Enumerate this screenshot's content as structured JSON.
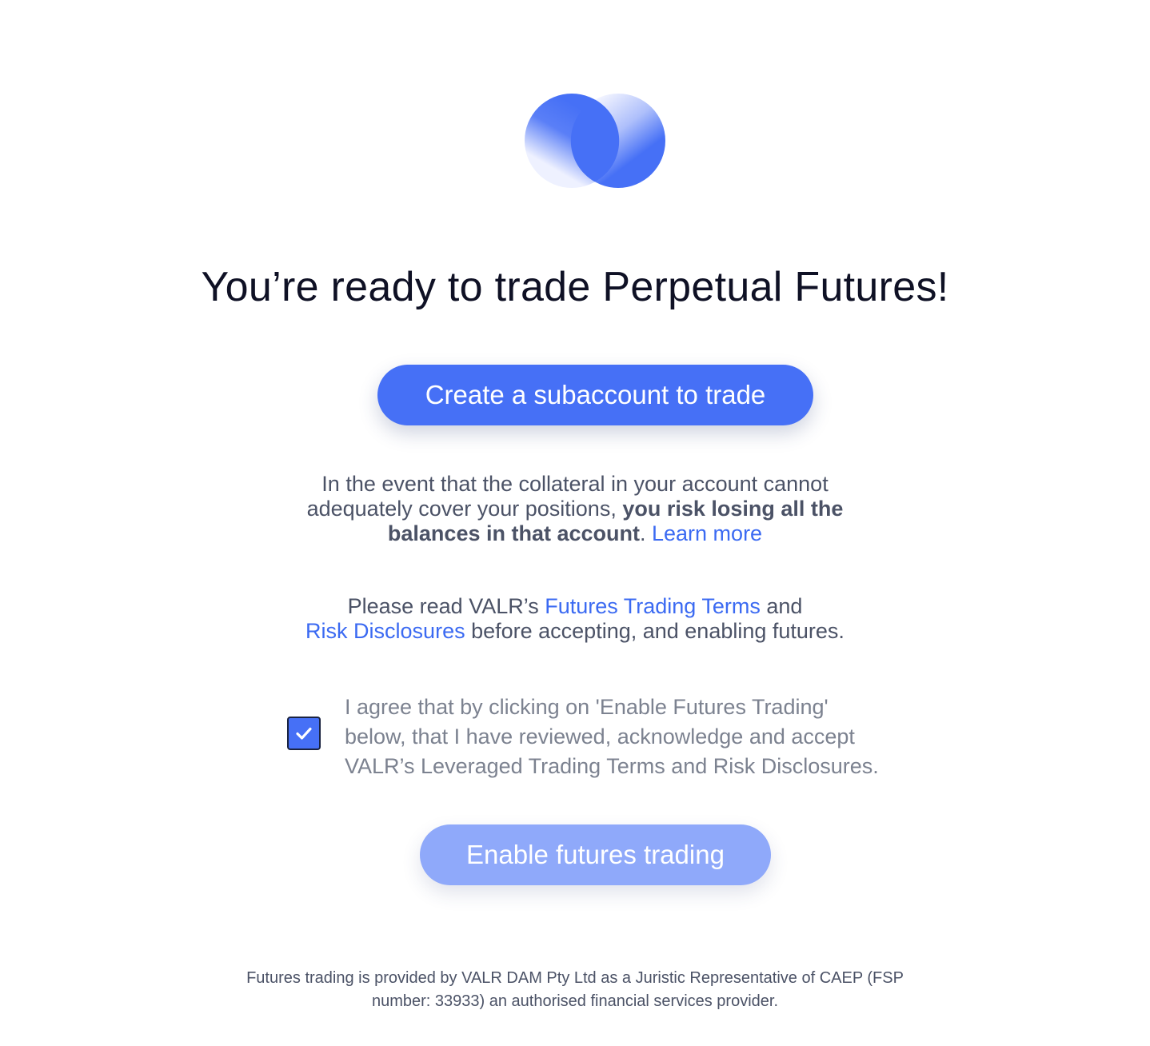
{
  "logo": {
    "name": "valr-logo",
    "colors": [
      "#4670f6",
      "#e6ebff"
    ]
  },
  "title": "You’re ready to trade Perpetual Futures!",
  "create_button": {
    "label": "Create a subaccount to trade",
    "color": "#4670f6"
  },
  "risk_notice": {
    "line1": "In the event that the collateral in your account cannot",
    "line2_start": "adequately cover your positions, ",
    "line2_bold": "you risk losing all the",
    "line3_bold": "balances in that account",
    "line3_after": ". ",
    "learn_more": "Learn more"
  },
  "terms_notice": {
    "prefix": "Please read VALR’s ",
    "futures_terms_link": "Futures Trading Terms",
    "middle": " and",
    "risk_disclosures_link": "Risk Disclosures",
    "suffix": " before accepting, and enabling futures."
  },
  "agreement": {
    "checked": true,
    "line1": "I agree that by clicking on 'Enable Futures Trading'",
    "line2": "below, that I have reviewed, acknowledge and accept",
    "line3": "VALR’s Leveraged Trading Terms and Risk Disclosures."
  },
  "enable_button": {
    "label": "Enable futures trading",
    "color": "#8fa9fa"
  },
  "footer": {
    "line1": "Futures trading is provided by VALR DAM Pty Ltd as a Juristic Representative of CAEP (FSP",
    "line2": "number: 33933) an authorised financial services provider."
  },
  "colors": {
    "accent": "#4670f6",
    "link": "#3b6af2",
    "title": "#0f1125",
    "body_text": "#4b5266",
    "muted_text": "#7c8290"
  }
}
